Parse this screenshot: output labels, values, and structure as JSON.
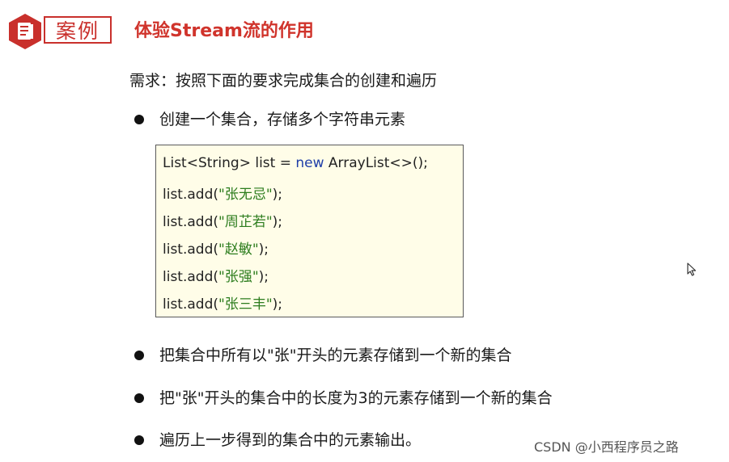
{
  "header": {
    "badge_label": "案例",
    "badge_icon": "document-icon",
    "title": "体验Stream流的作用",
    "accent_color": "#c9302c"
  },
  "requirement": "需求：按照下面的要求完成集合的创建和遍历",
  "bullets": [
    "创建一个集合，存储多个字符串元素",
    "把集合中所有以\"张\"开头的元素存储到一个新的集合",
    "把\"张\"开头的集合中的长度为3的元素存储到一个新的集合",
    "遍历上一步得到的集合中的元素输出。"
  ],
  "code": {
    "line1_pre": "List<String> list = ",
    "line1_kw": "new",
    "line1_post": " ArrayList<>();",
    "add_prefix": "list.add(",
    "add_suffix": ");",
    "names": [
      "\"张无忌\"",
      "\"周芷若\"",
      "\"赵敏\"",
      "\"张强\"",
      "\"张三丰\""
    ]
  },
  "watermark": "CSDN @小西程序员之路"
}
